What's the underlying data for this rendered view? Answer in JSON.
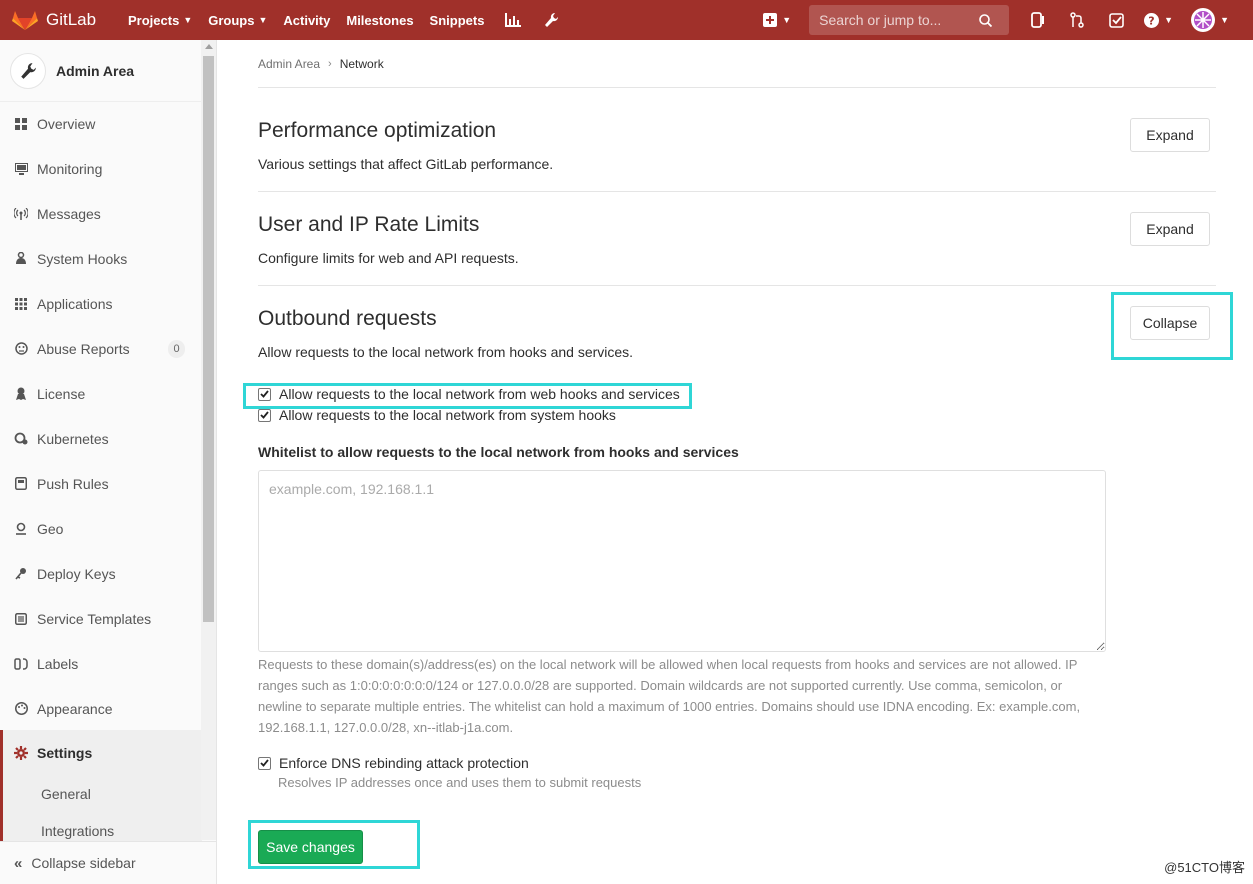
{
  "navbar": {
    "brand": "GitLab",
    "items": [
      {
        "label": "Projects",
        "dropdown": true
      },
      {
        "label": "Groups",
        "dropdown": true
      },
      {
        "label": "Activity",
        "dropdown": false
      },
      {
        "label": "Milestones",
        "dropdown": false
      },
      {
        "label": "Snippets",
        "dropdown": false
      }
    ],
    "search_placeholder": "Search or jump to..."
  },
  "sidebar": {
    "title": "Admin Area",
    "items": [
      {
        "label": "Overview",
        "icon": "overview-grid-icon"
      },
      {
        "label": "Monitoring",
        "icon": "monitor-icon"
      },
      {
        "label": "Messages",
        "icon": "broadcast-icon"
      },
      {
        "label": "System Hooks",
        "icon": "hook-icon"
      },
      {
        "label": "Applications",
        "icon": "apps-grid-icon"
      },
      {
        "label": "Abuse Reports",
        "icon": "abuse-icon",
        "badge": "0"
      },
      {
        "label": "License",
        "icon": "license-icon"
      },
      {
        "label": "Kubernetes",
        "icon": "kubernetes-icon"
      },
      {
        "label": "Push Rules",
        "icon": "push-rules-icon"
      },
      {
        "label": "Geo",
        "icon": "geo-pin-icon"
      },
      {
        "label": "Deploy Keys",
        "icon": "key-icon"
      },
      {
        "label": "Service Templates",
        "icon": "template-icon"
      },
      {
        "label": "Labels",
        "icon": "labels-icon"
      },
      {
        "label": "Appearance",
        "icon": "palette-icon"
      },
      {
        "label": "Settings",
        "icon": "gear-icon",
        "active": true
      }
    ],
    "subitems": [
      "General",
      "Integrations"
    ],
    "collapse_label": "Collapse sidebar"
  },
  "breadcrumb": {
    "parent": "Admin Area",
    "current": "Network"
  },
  "sections": {
    "performance": {
      "title": "Performance optimization",
      "desc": "Various settings that affect GitLab performance.",
      "button": "Expand"
    },
    "rate_limits": {
      "title": "User and IP Rate Limits",
      "desc": "Configure limits for web and API requests.",
      "button": "Expand"
    },
    "outbound": {
      "title": "Outbound requests",
      "desc": "Allow requests to the local network from hooks and services.",
      "button": "Collapse",
      "checkbox_web": {
        "label": "Allow requests to the local network from web hooks and services",
        "checked": true
      },
      "checkbox_system": {
        "label": "Allow requests to the local network from system hooks",
        "checked": true
      },
      "whitelist_label": "Whitelist to allow requests to the local network from hooks and services",
      "whitelist_placeholder": "example.com, 192.168.1.1",
      "whitelist_value": "",
      "help_text": "Requests to these domain(s)/address(es) on the local network will be allowed when local requests from hooks and services are not allowed. IP ranges such as 1:0:0:0:0:0:0:0/124 or 127.0.0.0/28 are supported. Domain wildcards are not supported currently. Use comma, semicolon, or newline to separate multiple entries. The whitelist can hold a maximum of 1000 entries. Domains should use IDNA encoding. Ex: example.com, 192.168.1.1, 127.0.0.0/28, xn--itlab-j1a.com.",
      "dns_checkbox": {
        "label": "Enforce DNS rebinding attack protection",
        "checked": true
      },
      "dns_help": "Resolves IP addresses once and uses them to submit requests",
      "save_button": "Save changes"
    }
  },
  "watermark": "@51CTO博客",
  "colors": {
    "navbar": "#a0302a",
    "save": "#1aaa55",
    "highlight": "#2fd6d6"
  }
}
